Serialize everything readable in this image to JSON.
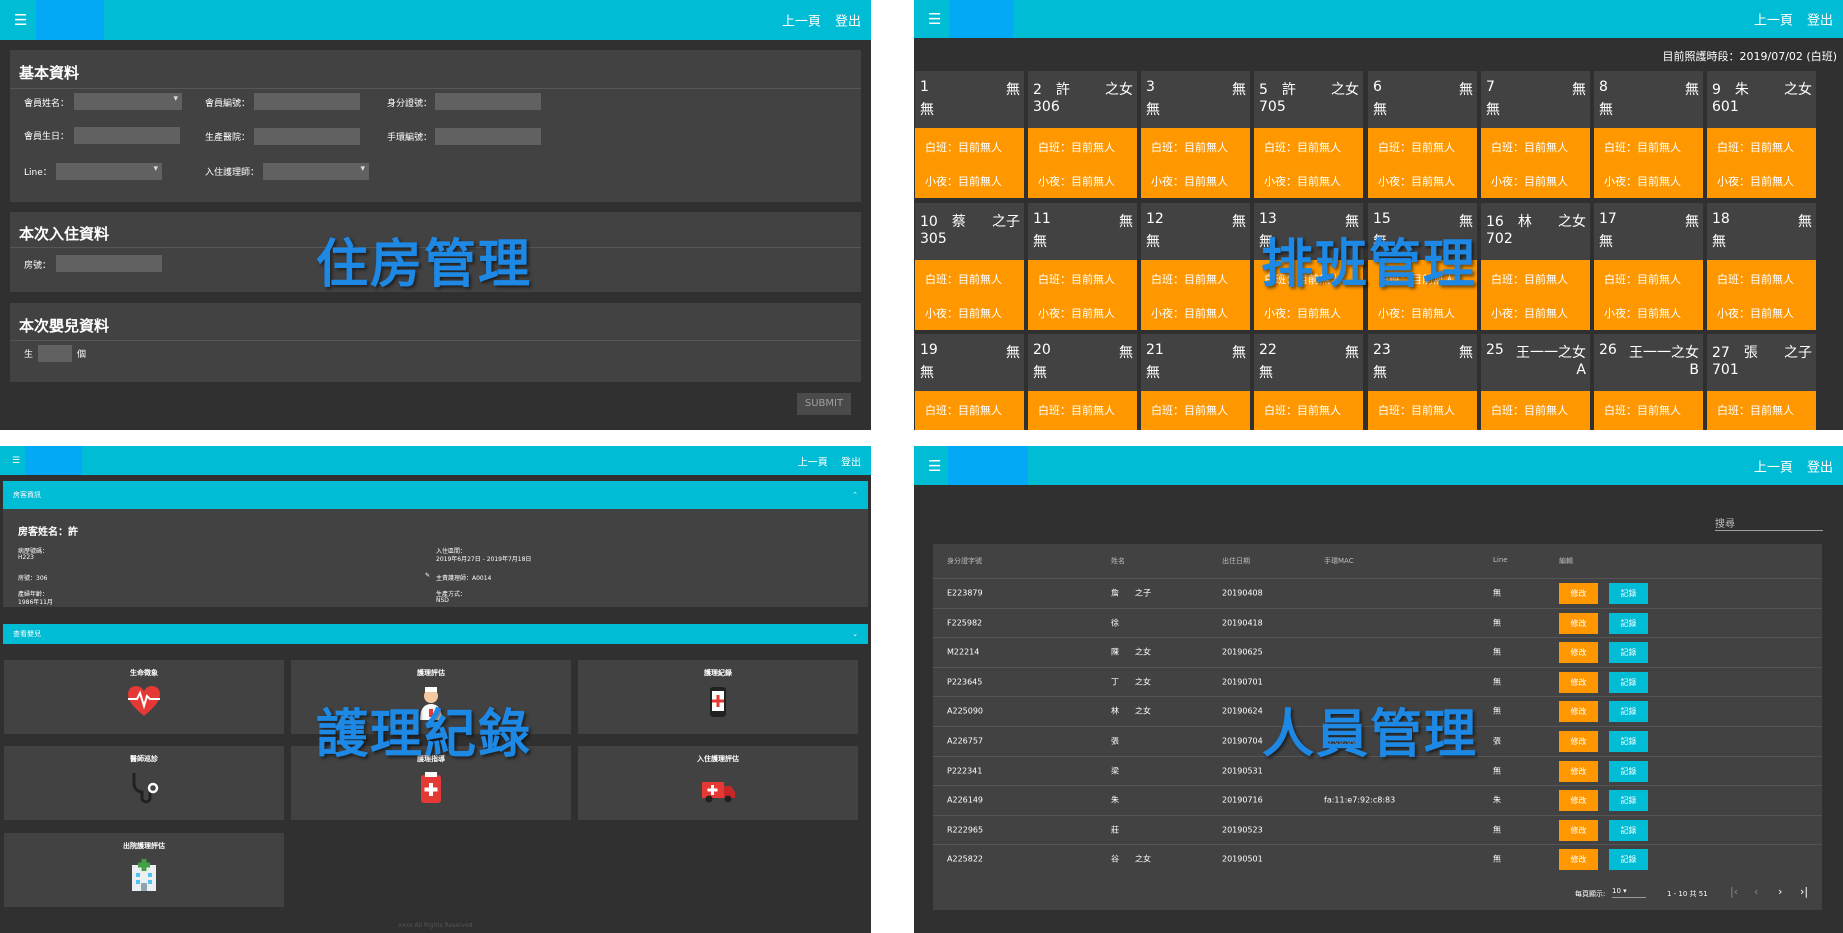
{
  "housing": {
    "topbar": {
      "prev": "上一頁",
      "logout": "登出"
    },
    "basic_title": "基本資料",
    "labels": {
      "member_name": "會員姓名：",
      "member_no": "會員編號：",
      "id_no": "身分證號：",
      "birthday": "會員生日：",
      "hospital": "生產醫院：",
      "bracelet": "手環編號：",
      "line": "Line：",
      "nurse": "入住護理師："
    },
    "stay_title": "本次入住資料",
    "room_label": "房號：",
    "baby_title": "本次嬰兒資料",
    "baby_prefix": "生",
    "baby_suffix": "個",
    "submit": "SUBMIT",
    "overlay": "住房管理"
  },
  "schedule": {
    "topbar": {
      "prev": "上一頁",
      "logout": "登出"
    },
    "period": "目前照護時段：2019/07/02 (白班)",
    "overlay": "排班管理",
    "day_label": "白班：目前無人",
    "night_label": "小夜：目前無人",
    "rooms": [
      {
        "num": "1",
        "name": "無",
        "sub": "無",
        "subr": ""
      },
      {
        "num": "2　許",
        "name": "之女",
        "sub": "306",
        "subr": ""
      },
      {
        "num": "3",
        "name": "無",
        "sub": "無",
        "subr": ""
      },
      {
        "num": "5　許",
        "name": "之女",
        "sub": "705",
        "subr": ""
      },
      {
        "num": "6",
        "name": "無",
        "sub": "無",
        "subr": ""
      },
      {
        "num": "7",
        "name": "無",
        "sub": "無",
        "subr": ""
      },
      {
        "num": "8",
        "name": "無",
        "sub": "無",
        "subr": ""
      },
      {
        "num": "9　朱",
        "name": "之女",
        "sub": "601",
        "subr": ""
      },
      {
        "num": "10　蔡",
        "name": "之子",
        "sub": "305",
        "subr": ""
      },
      {
        "num": "11",
        "name": "無",
        "sub": "無",
        "subr": ""
      },
      {
        "num": "12",
        "name": "無",
        "sub": "無",
        "subr": ""
      },
      {
        "num": "13",
        "name": "無",
        "sub": "無",
        "subr": ""
      },
      {
        "num": "15",
        "name": "無",
        "sub": "無",
        "subr": ""
      },
      {
        "num": "16　林",
        "name": "之女",
        "sub": "702",
        "subr": ""
      },
      {
        "num": "17",
        "name": "無",
        "sub": "無",
        "subr": ""
      },
      {
        "num": "18",
        "name": "無",
        "sub": "無",
        "subr": ""
      },
      {
        "num": "19",
        "name": "無",
        "sub": "無",
        "subr": ""
      },
      {
        "num": "20",
        "name": "無",
        "sub": "無",
        "subr": ""
      },
      {
        "num": "21",
        "name": "無",
        "sub": "無",
        "subr": ""
      },
      {
        "num": "22",
        "name": "無",
        "sub": "無",
        "subr": ""
      },
      {
        "num": "23",
        "name": "無",
        "sub": "無",
        "subr": ""
      },
      {
        "num": "25",
        "name": "王一一之女",
        "sub": "",
        "subr": "A"
      },
      {
        "num": "26",
        "name": "王一一之女",
        "sub": "",
        "subr": "B"
      },
      {
        "num": "27　張",
        "name": "之子",
        "sub": "701",
        "subr": ""
      }
    ]
  },
  "nursing": {
    "topbar": {
      "prev": "上一頁",
      "logout": "登出"
    },
    "bar1": "房客資訊",
    "bar2": "查看嬰兒",
    "guest_name": "房客姓名：許",
    "fields": {
      "bed_label": "病歷號碼：",
      "bed_value": "H223",
      "stay_label": "入住區間：",
      "stay_value": "2019年6月27日 - 2019年7月18日",
      "room_label": "房號：306",
      "nurse_label": "主責護理師：A0014",
      "birth_label": "產婦年齡：",
      "birth_value": "1986年11月",
      "delivery_label": "生產方式：",
      "delivery_value": "NSD"
    },
    "tiles": [
      "生命徵象",
      "護理評估",
      "護理紀錄",
      "醫師巡診",
      "護理指導",
      "入住護理評估",
      "出院護理評估"
    ],
    "footer": "xxxx All Rights Reserved",
    "overlay": "護理紀錄"
  },
  "staff": {
    "topbar": {
      "prev": "上一頁",
      "logout": "登出"
    },
    "search_placeholder": "搜尋",
    "headers": [
      "身分證字號",
      "姓名",
      "出住日期",
      "手環MAC",
      "Line",
      "編輯"
    ],
    "edit_label": "修改",
    "record_label": "記錄",
    "rows": [
      {
        "id": "E223879",
        "name": "詹　　之子",
        "date": "20190408",
        "mac": "",
        "line": "無"
      },
      {
        "id": "F225982",
        "name": "徐",
        "date": "20190418",
        "mac": "",
        "line": "無"
      },
      {
        "id": "M22214",
        "name": "陳　　之女",
        "date": "20190625",
        "mac": "",
        "line": "無"
      },
      {
        "id": "P223645",
        "name": "丁　　之女",
        "date": "20190701",
        "mac": "",
        "line": "無"
      },
      {
        "id": "A225090",
        "name": "林　　之女",
        "date": "20190624",
        "mac": "",
        "line": "無"
      },
      {
        "id": "A226757",
        "name": "張",
        "date": "20190704",
        "mac": "fa:c8:80",
        "line": "張"
      },
      {
        "id": "P222341",
        "name": "梁",
        "date": "20190531",
        "mac": "",
        "line": "無"
      },
      {
        "id": "A226149",
        "name": "朱",
        "date": "20190716",
        "mac": "fa:11:e7:92:c8:83",
        "line": "朱"
      },
      {
        "id": "R222965",
        "name": "莊",
        "date": "20190523",
        "mac": "",
        "line": "無"
      },
      {
        "id": "A225822",
        "name": "谷　　之女",
        "date": "20190501",
        "mac": "",
        "line": "無"
      }
    ],
    "pager": {
      "per_page_label": "每頁顯示:",
      "per_page": "10",
      "range": "1 - 10 共 51"
    },
    "overlay": "人員管理"
  },
  "colors": {
    "topbar": "#00bcd4",
    "orange": "#ff9800",
    "dark": "#303030",
    "card": "#424242"
  }
}
